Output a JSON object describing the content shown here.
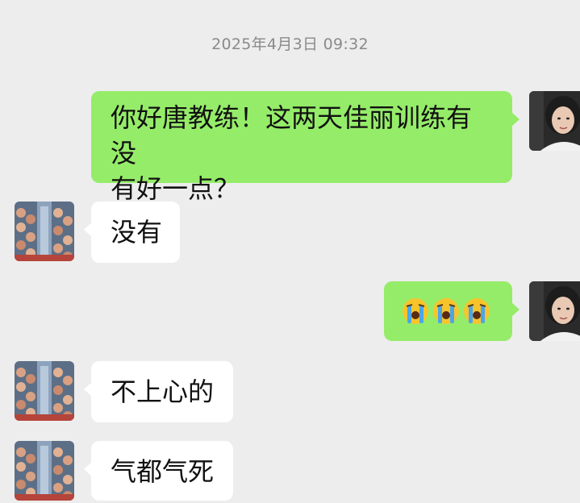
{
  "chat": {
    "timestamp": "2025年4月3日 09:32",
    "messages": [
      {
        "direction": "outgoing",
        "text": "你好唐教练！这两天佳丽训练有没有好一点？"
      },
      {
        "direction": "incoming",
        "text": "没有"
      },
      {
        "direction": "outgoing",
        "emojis": [
          "loudly-crying-face-emoji",
          "loudly-crying-face-emoji",
          "loudly-crying-face-emoji"
        ]
      },
      {
        "direction": "incoming",
        "text": "不上心的"
      },
      {
        "direction": "incoming",
        "text": "气都气死"
      }
    ]
  },
  "line1": "你好唐教练！这两天佳丽训练有没",
  "line2": "有好一点？",
  "colors": {
    "background": "#ededed",
    "outgoing_bubble": "#95ec69",
    "incoming_bubble": "#ffffff",
    "timestamp_text": "#8a8a8a"
  }
}
